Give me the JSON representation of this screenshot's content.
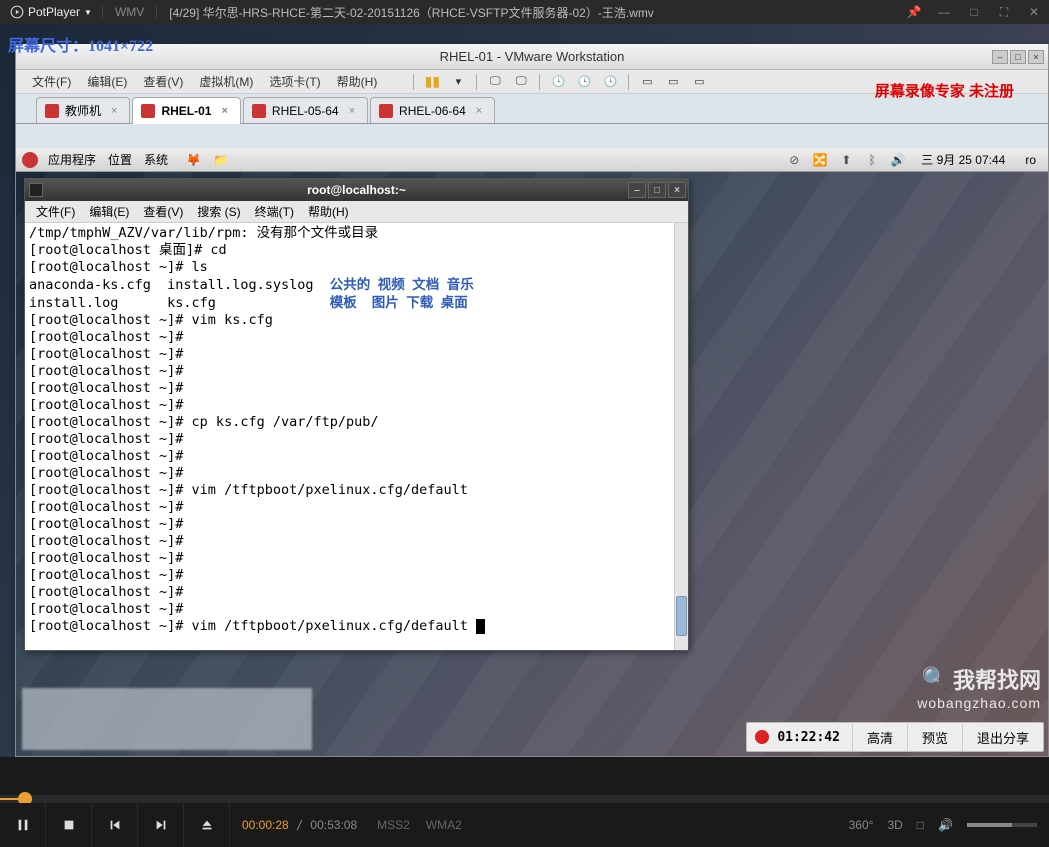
{
  "potplayer": {
    "logo": "PotPlayer",
    "format": "WMV",
    "title": "[4/29] 华尔思-HRS-RHCE-第二天-02-20151126（RHCE-VSFTP文件服务器-02）-王浩.wmv",
    "time_current": "00:00:28",
    "time_total": "00:53:08",
    "codec_v": "MSS2",
    "codec_a": "WMA2",
    "r1": "360°",
    "r2": "3D",
    "r3": "□"
  },
  "screen_size": "屏幕尺寸：1041×722",
  "vmware": {
    "title": "RHEL-01 - VMware Workstation",
    "watermark": "屏幕录像专家  未注册",
    "menu": {
      "file": "文件(F)",
      "edit": "编辑(E)",
      "view": "查看(V)",
      "vm": "虚拟机(M)",
      "tabs": "选项卡(T)",
      "help": "帮助(H)"
    },
    "tabs": [
      {
        "label": "教师机"
      },
      {
        "label": "RHEL-01"
      },
      {
        "label": "RHEL-05-64"
      },
      {
        "label": "RHEL-06-64"
      }
    ]
  },
  "gnome": {
    "apps": "应用程序",
    "places": "位置",
    "system": "系统",
    "date": "三  9月 25 07:44",
    "user": "ro"
  },
  "terminal": {
    "title": "root@localhost:~",
    "menu": {
      "file": "文件(F)",
      "edit": "编辑(E)",
      "view": "查看(V)",
      "search": "搜索 (S)",
      "term": "终端(T)",
      "help": "帮助(H)"
    },
    "lines": [
      {
        "t": "/tmp/tmphW_AZV/var/lib/rpm: 没有那个文件或目录"
      },
      {
        "t": "[root@localhost 桌面]# cd"
      },
      {
        "t": "[root@localhost ~]# ls"
      },
      {
        "t": "anaconda-ks.cfg  install.log.syslog  ",
        "b": "公共的  视频  文档  音乐"
      },
      {
        "t": "install.log      ks.cfg              ",
        "b": "模板    图片  下载  桌面"
      },
      {
        "t": "[root@localhost ~]# vim ks.cfg"
      },
      {
        "t": "[root@localhost ~]# "
      },
      {
        "t": "[root@localhost ~]# "
      },
      {
        "t": "[root@localhost ~]# "
      },
      {
        "t": "[root@localhost ~]# "
      },
      {
        "t": "[root@localhost ~]# "
      },
      {
        "t": "[root@localhost ~]# cp ks.cfg /var/ftp/pub/"
      },
      {
        "t": "[root@localhost ~]# "
      },
      {
        "t": "[root@localhost ~]# "
      },
      {
        "t": "[root@localhost ~]# "
      },
      {
        "t": "[root@localhost ~]# vim /tftpboot/pxelinux.cfg/default"
      },
      {
        "t": "[root@localhost ~]# "
      },
      {
        "t": "[root@localhost ~]# "
      },
      {
        "t": "[root@localhost ~]# "
      },
      {
        "t": "[root@localhost ~]# "
      },
      {
        "t": "[root@localhost ~]# "
      },
      {
        "t": "[root@localhost ~]# "
      },
      {
        "t": "[root@localhost ~]# "
      },
      {
        "t": "[root@localhost ~]# vim /tftpboot/pxelinux.cfg/default ",
        "cursor": true
      }
    ]
  },
  "recbar": {
    "time": "01:22:42",
    "hd": "高清",
    "preview": "预览",
    "exit": "退出分享"
  },
  "watermark": {
    "name": "我帮找网",
    "url": "wobangzhao.com"
  }
}
